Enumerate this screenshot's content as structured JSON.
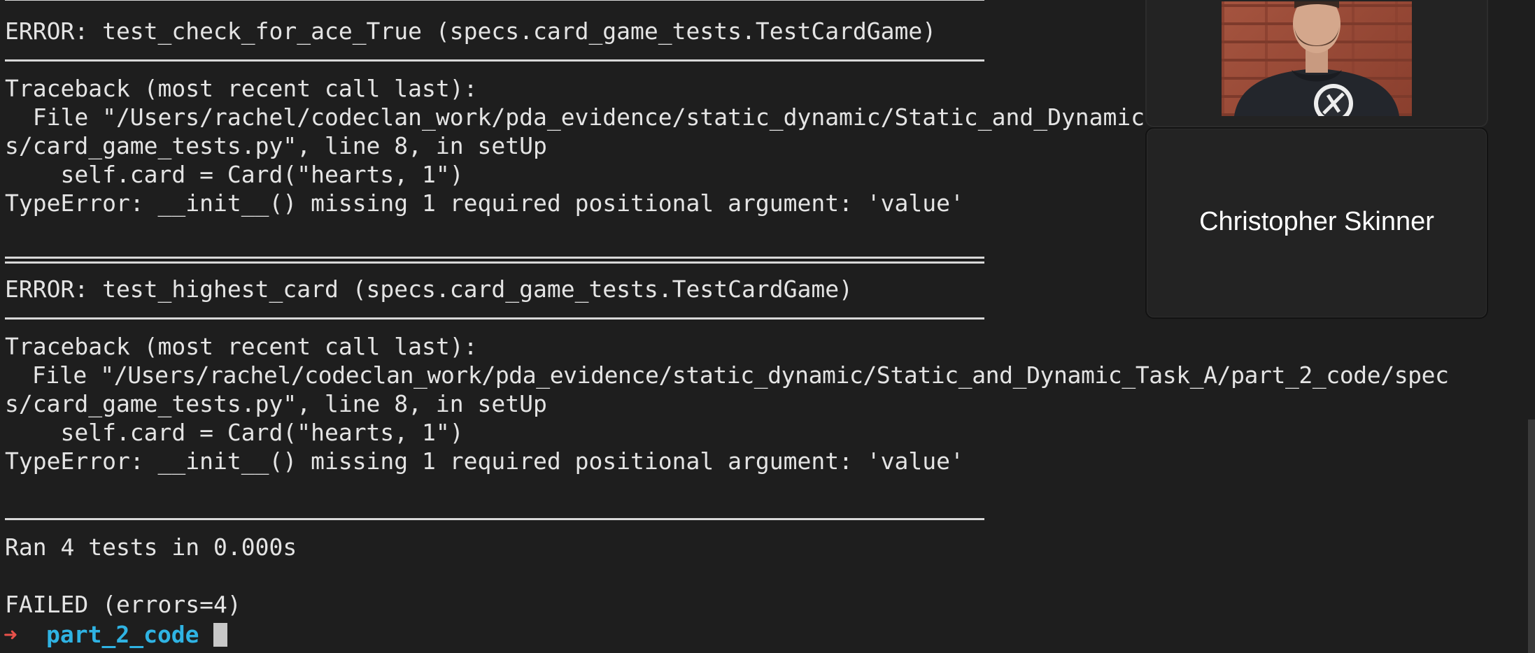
{
  "terminal": {
    "lines": {
      "l1": "ERROR: test_check_for_ace_True (specs.card_game_tests.TestCardGame)",
      "l3": "Traceback (most recent call last):",
      "l4": "  File \"/Users/rachel/codeclan_work/pda_evidence/static_dynamic/Static_and_Dynamic",
      "l5": "s/card_game_tests.py\", line 8, in setUp",
      "l6": "    self.card = Card(\"hearts, 1\")",
      "l7": "TypeError: __init__() missing 1 required positional argument: 'value'",
      "l10": "ERROR: test_highest_card (specs.card_game_tests.TestCardGame)",
      "l12": "Traceback (most recent call last):",
      "l13": "  File \"/Users/rachel/codeclan_work/pda_evidence/static_dynamic/Static_and_Dynamic_Task_A/part_2_code/spec",
      "l14": "s/card_game_tests.py\", line 8, in setUp",
      "l15": "    self.card = Card(\"hearts, 1\")",
      "l16": "TypeError: __init__() missing 1 required positional argument: 'value'",
      "l19": "Ran 4 tests in 0.000s",
      "l21": "FAILED (errors=4)"
    },
    "prompt": {
      "arrow": "➜",
      "directory": "part_2_code"
    },
    "colors": {
      "background": "#1e1e1e",
      "text": "#e4e4e4",
      "prompt_arrow": "#e8514a",
      "prompt_directory": "#2fb3e3"
    }
  },
  "video_call": {
    "participant_name": "Christopher Skinner"
  }
}
